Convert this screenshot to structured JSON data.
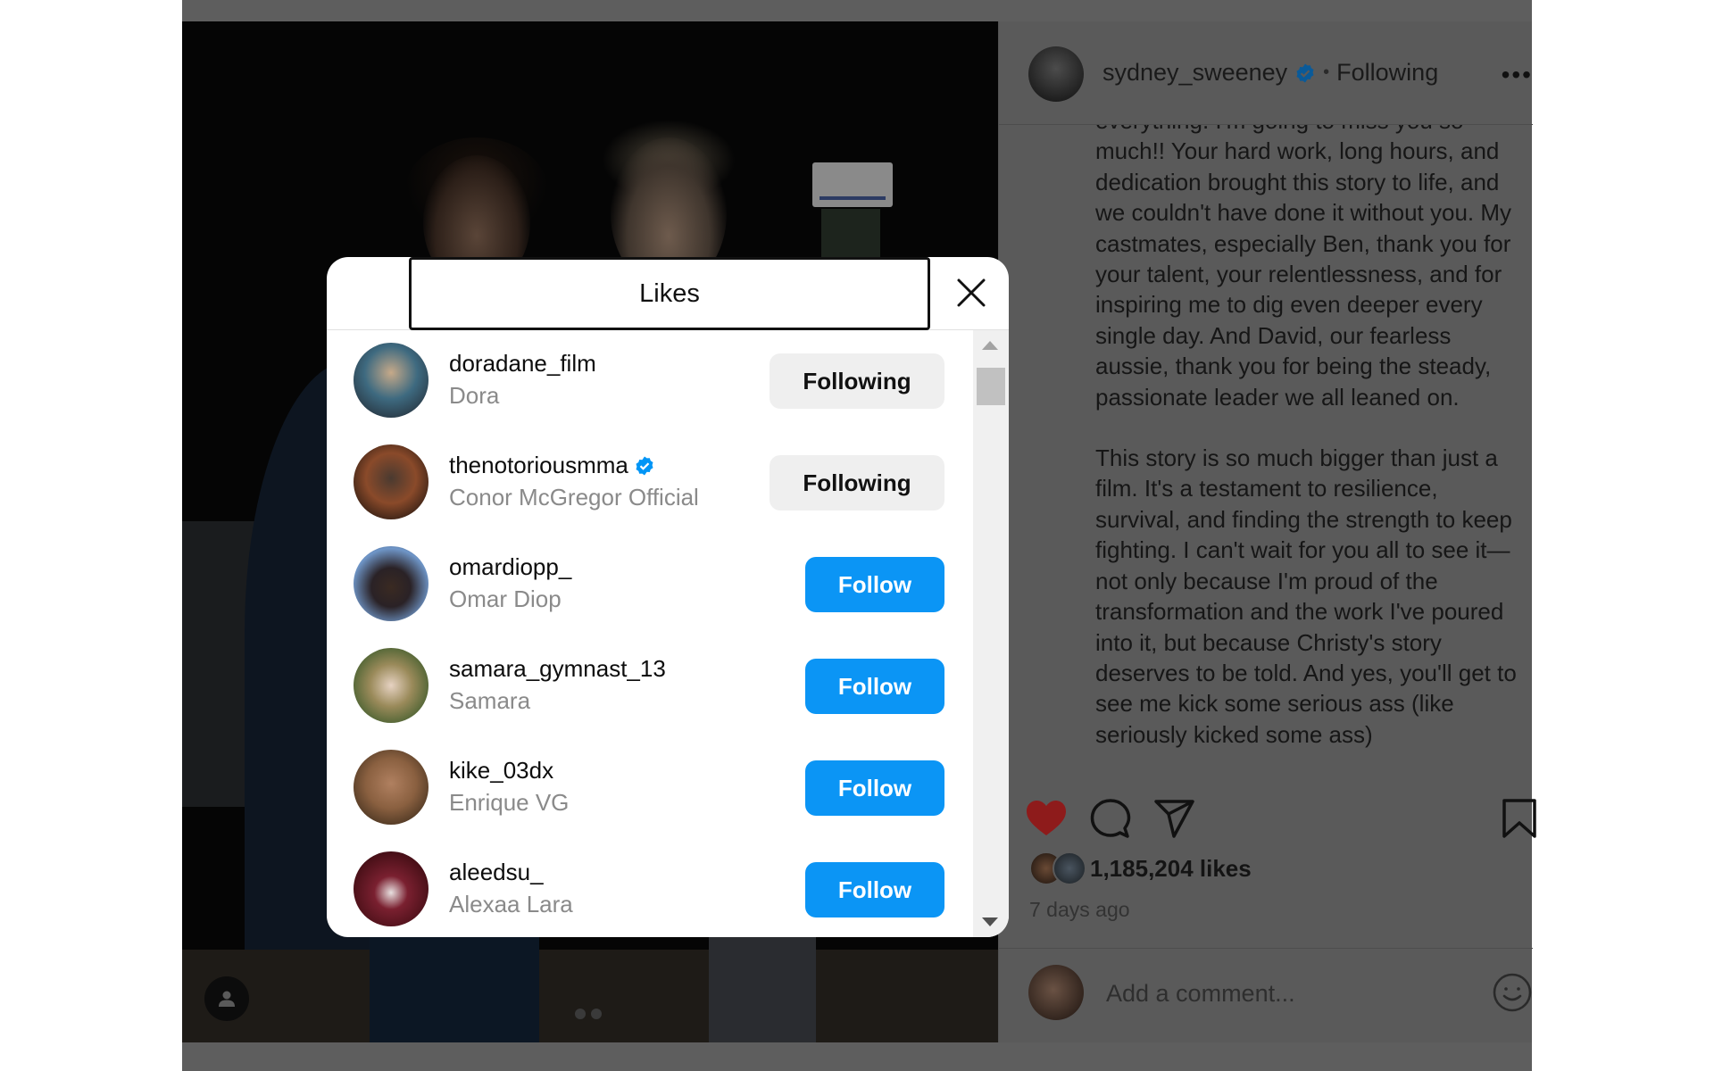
{
  "post": {
    "author": {
      "username": "sydney_sweeney",
      "verified": true,
      "separator": "•",
      "follow_status": "Following",
      "more_label": "•••"
    },
    "caption": {
      "paragraphs": [
        "everything. I'm going to miss you so much!! Your hard work, long hours, and dedication brought this story to life, and we couldn't have done it without you. My castmates, especially Ben, thank you for your talent, your relentlessness, and for inspiring me to dig even deeper every single day. And David, our fearless aussie, thank you for being the steady, passionate leader we all leaned on.",
        "This story is so much bigger than just a film. It's a testament to resilience, survival, and finding the strength to keep fighting. I can't wait for you all to see it—not only because I'm proud of the transformation and the work I've poured into it, but because Christy's story deserves to be told. And yes, you'll get to see me kick some serious ass (like seriously kicked some ass)"
      ]
    },
    "actions": {
      "like_icon": "heart-filled-icon",
      "comment_icon": "comment-icon",
      "share_icon": "send-icon",
      "save_icon": "bookmark-icon",
      "liked": true
    },
    "likes_text": "1,185,204 likes",
    "time_ago": "7 days ago",
    "comment": {
      "placeholder": "Add a comment...",
      "emoji_icon": "smiley-icon"
    },
    "media": {
      "tag_icon": "user-tag-icon",
      "carousel_count": 2,
      "carousel_active_index": 0
    }
  },
  "likes_modal": {
    "title": "Likes",
    "close_icon": "close-icon",
    "users": [
      {
        "username": "doradane_film",
        "full_name": "Dora",
        "verified": false,
        "button": "Following",
        "is_following": true
      },
      {
        "username": "thenotoriousmma",
        "full_name": "Conor McGregor Official",
        "verified": true,
        "button": "Following",
        "is_following": true
      },
      {
        "username": "omardiopp_",
        "full_name": "Omar Diop",
        "verified": false,
        "button": "Follow",
        "is_following": false
      },
      {
        "username": "samara_gymnast_13",
        "full_name": "Samara",
        "verified": false,
        "button": "Follow",
        "is_following": false
      },
      {
        "username": "kike_03dx",
        "full_name": "Enrique VG",
        "verified": false,
        "button": "Follow",
        "is_following": false
      },
      {
        "username": "aleedsu_",
        "full_name": "Alexaa Lara",
        "verified": false,
        "button": "Follow",
        "is_following": false
      }
    ]
  },
  "colors": {
    "follow_blue": "#0b95f5",
    "following_gray": "#efefef",
    "verified_blue": "#0095f6",
    "like_red": "#8e1b1b"
  }
}
